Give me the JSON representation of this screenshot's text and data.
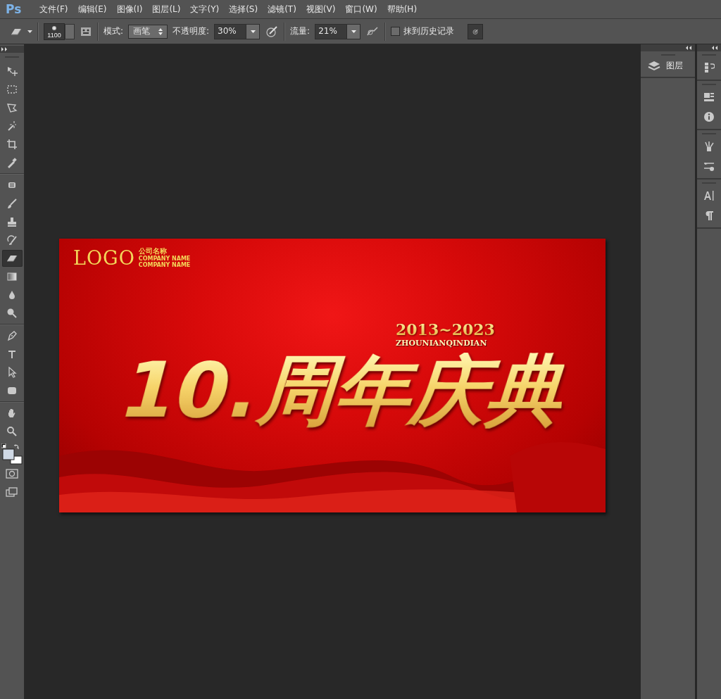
{
  "menu": {
    "logo": "Ps",
    "items": [
      "文件(F)",
      "编辑(E)",
      "图像(I)",
      "图层(L)",
      "文字(Y)",
      "选择(S)",
      "滤镜(T)",
      "视图(V)",
      "窗口(W)",
      "帮助(H)"
    ]
  },
  "options": {
    "brush_size": "1100",
    "mode_label": "模式:",
    "mode_value": "画笔",
    "opacity_label": "不透明度:",
    "opacity_value": "30%",
    "flow_label": "流量:",
    "flow_value": "21%",
    "erase_history": {
      "label": "抹到历史记录",
      "checked": false
    }
  },
  "tools": [
    {
      "kind": "move",
      "selected": false
    },
    {
      "kind": "marquee",
      "selected": false
    },
    {
      "kind": "lasso",
      "selected": false
    },
    {
      "kind": "wand",
      "selected": false
    },
    {
      "kind": "crop",
      "selected": false
    },
    {
      "kind": "eyedropper",
      "selected": false
    },
    {
      "kind": "healing",
      "selected": false
    },
    {
      "kind": "brush",
      "selected": false
    },
    {
      "kind": "stamp",
      "selected": false
    },
    {
      "kind": "history",
      "selected": false
    },
    {
      "kind": "eraser",
      "selected": true
    },
    {
      "kind": "gradient",
      "selected": false
    },
    {
      "kind": "blur",
      "selected": false
    },
    {
      "kind": "dodge",
      "selected": false
    },
    {
      "kind": "pen",
      "selected": false
    },
    {
      "kind": "type",
      "selected": false
    },
    {
      "kind": "select",
      "selected": false
    },
    {
      "kind": "shape",
      "selected": false
    },
    {
      "kind": "hand",
      "selected": false
    },
    {
      "kind": "zoom",
      "selected": false
    }
  ],
  "panels": {
    "layers_tab": "图层"
  },
  "document": {
    "logo": "LOGO",
    "company": "公司名称",
    "company_en": [
      "COMPANY NAME",
      "COMPANY NAME"
    ],
    "years": "2013~2023",
    "pinyin": "ZHOUNIANQINDIAN",
    "headline": "10.周年庆典"
  }
}
